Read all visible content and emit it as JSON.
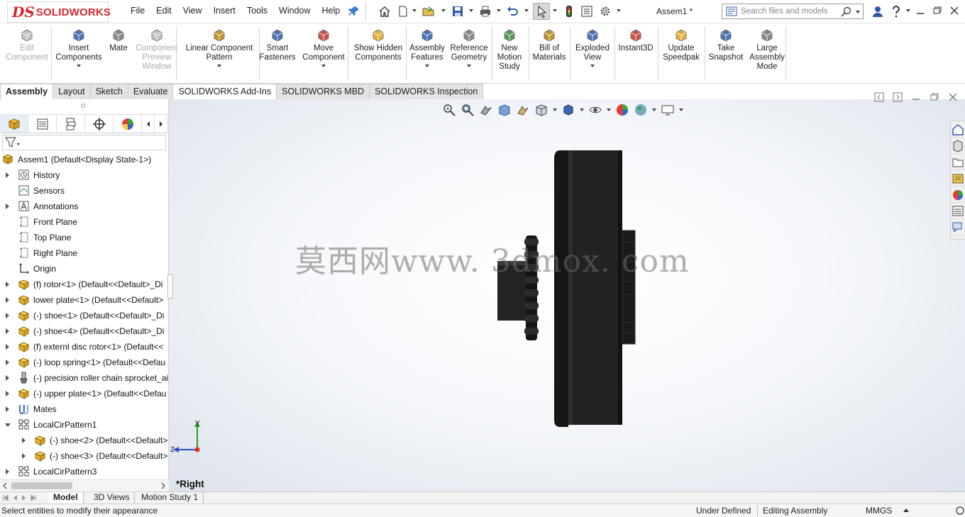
{
  "app": {
    "brand": "SOLIDWORKS",
    "logo_mark": "DS",
    "doc_title": "Assem1 *"
  },
  "menu": [
    "File",
    "Edit",
    "View",
    "Insert",
    "Tools",
    "Window",
    "Help"
  ],
  "search": {
    "placeholder": "Search files and models"
  },
  "commands": [
    {
      "id": "edit-component",
      "label": "Edit Component",
      "enabled": false,
      "dropdown": false
    },
    {
      "id": "insert-components",
      "label": "Insert Components",
      "enabled": true,
      "dropdown": true
    },
    {
      "id": "mate",
      "label": "Mate",
      "enabled": true,
      "dropdown": false
    },
    {
      "id": "component-preview-window",
      "label": "Component Preview Window",
      "enabled": false,
      "dropdown": false
    },
    {
      "id": "linear-component-pattern",
      "label": "Linear Component Pattern",
      "enabled": true,
      "dropdown": true
    },
    {
      "id": "smart-fasteners",
      "label": "Smart Fasteners",
      "enabled": true,
      "dropdown": false
    },
    {
      "id": "move-component",
      "label": "Move Component",
      "enabled": true,
      "dropdown": true
    },
    {
      "id": "show-hidden-components",
      "label": "Show Hidden Components",
      "enabled": true,
      "dropdown": false
    },
    {
      "id": "assembly-features",
      "label": "Assembly Features",
      "enabled": true,
      "dropdown": true
    },
    {
      "id": "reference-geometry",
      "label": "Reference Geometry",
      "enabled": true,
      "dropdown": true
    },
    {
      "id": "new-motion-study",
      "label": "New Motion Study",
      "enabled": true,
      "dropdown": false
    },
    {
      "id": "bill-of-materials",
      "label": "Bill of Materials",
      "enabled": true,
      "dropdown": false
    },
    {
      "id": "exploded-view",
      "label": "Exploded View",
      "enabled": true,
      "dropdown": true
    },
    {
      "id": "instant3d",
      "label": "Instant3D",
      "enabled": true,
      "dropdown": false
    },
    {
      "id": "update-speedpak",
      "label": "Update Speedpak",
      "enabled": true,
      "dropdown": false
    },
    {
      "id": "take-snapshot",
      "label": "Take Snapshot",
      "enabled": true,
      "dropdown": false
    },
    {
      "id": "large-assembly-mode",
      "label": "Large Assembly Mode",
      "enabled": true,
      "dropdown": false
    }
  ],
  "tabs": [
    {
      "label": "Assembly",
      "active": true
    },
    {
      "label": "Layout"
    },
    {
      "label": "Sketch"
    },
    {
      "label": "Evaluate"
    },
    {
      "label": "SOLIDWORKS Add-Ins",
      "selected": true
    },
    {
      "label": "SOLIDWORKS MBD"
    },
    {
      "label": "SOLIDWORKS Inspection"
    }
  ],
  "tree": [
    {
      "label": "Assem1  (Default<Display State-1>)",
      "icon": "assembly-icon",
      "level": 0,
      "expander": "none"
    },
    {
      "label": "History",
      "icon": "history-icon",
      "level": 1,
      "expander": "closed"
    },
    {
      "label": "Sensors",
      "icon": "sensors-icon",
      "level": 1,
      "expander": "none"
    },
    {
      "label": "Annotations",
      "icon": "annotations-icon",
      "level": 1,
      "expander": "closed"
    },
    {
      "label": "Front Plane",
      "icon": "plane-icon",
      "level": 1,
      "expander": "none"
    },
    {
      "label": "Top Plane",
      "icon": "plane-icon",
      "level": 1,
      "expander": "none"
    },
    {
      "label": "Right Plane",
      "icon": "plane-icon",
      "level": 1,
      "expander": "none"
    },
    {
      "label": "Origin",
      "icon": "origin-icon",
      "level": 1,
      "expander": "none"
    },
    {
      "label": "(f) rotor<1> (Default<<Default>_Di",
      "icon": "part-icon",
      "level": 1,
      "expander": "closed"
    },
    {
      "label": "lower plate<1> (Default<<Default>",
      "icon": "part-icon",
      "level": 1,
      "expander": "closed"
    },
    {
      "label": "(-) shoe<1> (Default<<Default>_Di",
      "icon": "part-icon",
      "level": 1,
      "expander": "closed"
    },
    {
      "label": "(-) shoe<4> (Default<<Default>_Di",
      "icon": "part-icon",
      "level": 1,
      "expander": "closed"
    },
    {
      "label": "(f) externl disc rotor<1> (Default<<",
      "icon": "part-icon",
      "level": 1,
      "expander": "closed"
    },
    {
      "label": "(-) loop spring<1> (Default<<Defau",
      "icon": "part-icon",
      "level": 1,
      "expander": "closed"
    },
    {
      "label": "(-) precision roller chain sprocket_ai",
      "icon": "toolbox-part-icon",
      "level": 1,
      "expander": "closed"
    },
    {
      "label": "(-) upper plate<1> (Default<<Defau",
      "icon": "part-icon",
      "level": 1,
      "expander": "closed"
    },
    {
      "label": "Mates",
      "icon": "mates-icon",
      "level": 1,
      "expander": "closed"
    },
    {
      "label": "LocalCirPattern1",
      "icon": "pattern-icon",
      "level": 1,
      "expander": "open"
    },
    {
      "label": "(-) shoe<2> (Default<<Default>",
      "icon": "part-icon",
      "level": 2,
      "expander": "closed"
    },
    {
      "label": "(-) shoe<3> (Default<<Default>",
      "icon": "part-icon",
      "level": 2,
      "expander": "closed"
    },
    {
      "label": "LocalCirPattern3",
      "icon": "pattern-icon",
      "level": 1,
      "expander": "closed"
    }
  ],
  "viewport": {
    "view_name": "*Right",
    "watermark": "莫西网www. 3dmox. com",
    "triad": {
      "y": "Y",
      "z": "Z"
    }
  },
  "bottom_tabs": [
    {
      "label": "Model",
      "active": true
    },
    {
      "label": "3D Views"
    },
    {
      "label": "Motion Study 1"
    }
  ],
  "status": {
    "message": "Select entities to modify their appearance",
    "definition": "Under Defined",
    "mode": "Editing Assembly",
    "units": "MMGS"
  },
  "colors": {
    "brand": "#d8242b",
    "model": "#1e1e1e"
  }
}
